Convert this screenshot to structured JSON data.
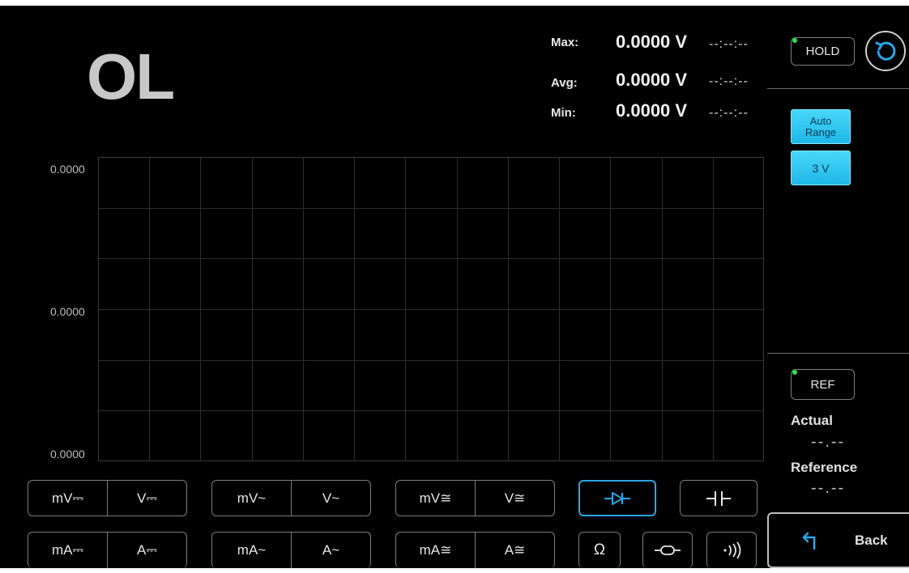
{
  "reading": {
    "main": "OL"
  },
  "stats": [
    {
      "label": "Max:",
      "value": "0.0000 V",
      "time": "--:--:--"
    },
    {
      "label": "Avg:",
      "value": "0.0000 V",
      "time": "--:--:--"
    },
    {
      "label": "Min:",
      "value": "0.0000 V",
      "time": "--:--:--"
    }
  ],
  "graph": {
    "labels": [
      "0.0000",
      "0.0000",
      "0.0000"
    ]
  },
  "side": {
    "hold_label": "HOLD",
    "auto_range_label": "Auto\nRange",
    "range_label": "3 V",
    "ref_label": "REF",
    "actual_label": "Actual",
    "actual_value": "--.--",
    "reference_label": "Reference",
    "reference_value": "--.--",
    "back_label": "Back"
  },
  "modes": {
    "row1": [
      [
        "mV⎓",
        "V⎓"
      ],
      [
        "mV~",
        "V~"
      ],
      [
        "mV≅",
        "V≅"
      ]
    ],
    "row2": [
      [
        "mA⎓",
        "A⎓"
      ],
      [
        "mA~",
        "A~"
      ],
      [
        "mA≅",
        "A≅"
      ]
    ],
    "ohm_symbol": "Ω",
    "active_mode": "diode",
    "accent_color": "#2aa6e8"
  },
  "icons": [
    "diode-icon",
    "capacitor-icon",
    "fuse-icon",
    "continuity-icon",
    "refresh-icon",
    "back-arrow-icon"
  ]
}
